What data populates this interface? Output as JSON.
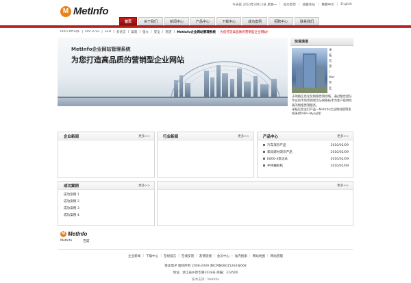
{
  "site": {
    "logo_letter": "M",
    "logo_text": "MetInfo",
    "accent": "#c81e1e",
    "logo_color": "#e8821c"
  },
  "toplinks": {
    "date": "今天是 2010年4月12日 星期一",
    "set_home": "设为首页",
    "favorite": "收藏本站",
    "traditional": "繁體中文",
    "english": "English"
  },
  "nav": [
    {
      "label": "首页",
      "active": true
    },
    {
      "label": "关于我们"
    },
    {
      "label": "新闻中心"
    },
    {
      "label": "产品中心"
    },
    {
      "label": "下载中心"
    },
    {
      "label": "成功案例"
    },
    {
      "label": "招聘中心"
    },
    {
      "label": "联系我们"
    }
  ],
  "breadcrumb": {
    "items": [
      "PHP+MYSQL",
      "DIV+CSS",
      "SEO",
      "多语言",
      "美观",
      "强大",
      "安全",
      "稳定"
    ],
    "current": "MetInfo企业网站管理系统",
    "slogan": "- 为您打造高品质的营销型企业网站!"
  },
  "banner": {
    "line1": "MetInfo企业网站管理系统",
    "line2": "为您打造高品质的营销型企业网站"
  },
  "quick": {
    "title": "快速通道",
    "side_chars": [
      "米",
      "拓",
      "信",
      "息",
      "(",
      "Met",
      "专",
      "业",
      "于"
    ],
    "text": "于网络信息化及网络营销领域，通过整合团队专业的市场营销理念与网络技术为客户提供优质的网络营销服务。",
    "text2": "米拓信息主打产品—MetInfo企业网站管理系统采用PHP+Mysql架"
  },
  "panels": {
    "company_news": {
      "title": "企业新闻",
      "more": "更多>>"
    },
    "industry_news": {
      "title": "行业新闻",
      "more": "更多>>"
    },
    "products": {
      "title": "产品中心",
      "more": "更多>>",
      "items": [
        {
          "name": "汽车演示产品",
          "date": "2010/02/09"
        },
        {
          "name": "家具建材演示产品",
          "date": "2010/02/09"
        },
        {
          "name": "E800-4笔记本",
          "date": "2010/02/09"
        },
        {
          "name": "手持摄影机",
          "date": "2010/02/09"
        }
      ]
    },
    "cases": {
      "title": "成功案例",
      "more": "更多>>",
      "items": [
        "成功案例 1",
        "成功案例 2",
        "成功案例 3",
        "成功案例 4"
      ]
    },
    "empty": {
      "more": "更多>>"
    }
  },
  "links": {
    "logo_text": "MetInfo",
    "items": [
      "MetInfo",
      "百度"
    ]
  },
  "footer": {
    "nav": [
      "企业新闻",
      "下载中心",
      "在线留言",
      "在线反馈",
      "友情链接",
      "会员中心",
      "站内搜索",
      "网站地图",
      "网站管理"
    ],
    "copyright": "受美电子 版权所有 2008-2009 浙ICP备08015264号668",
    "address": "地址：浙江省乡新华路1028号 邮编：314500",
    "more": "技术支持：MetInfo"
  }
}
